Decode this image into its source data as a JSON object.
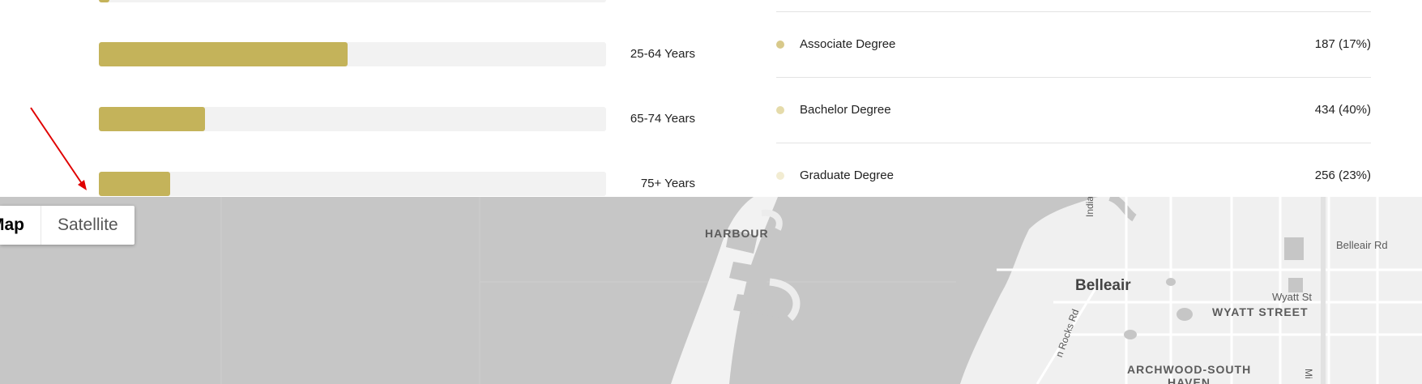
{
  "age_bars": [
    {
      "label": "",
      "value_pct": 2
    },
    {
      "label": "25-64 Years",
      "value_pct": 49
    },
    {
      "label": "65-74 Years",
      "value_pct": 21
    },
    {
      "label": "75+ Years",
      "value_pct": 14
    }
  ],
  "education": {
    "items": [
      {
        "label": "Associate Degree",
        "value": "187 (17%)",
        "color": "#d8c98a"
      },
      {
        "label": "Bachelor Degree",
        "value": "434 (40%)",
        "color": "#e5dbaa"
      },
      {
        "label": "Graduate Degree",
        "value": "256 (23%)",
        "color": "#f2ecd2"
      }
    ]
  },
  "map": {
    "type_control": {
      "map_label": "Map",
      "satellite_label": "Satellite"
    },
    "labels": {
      "harbour": "HARBOUR",
      "belleair": "Belleair",
      "belleair_rd": "Belleair Rd",
      "wyatt_st": "Wyatt St",
      "wyatt_street": "WYATT STREET",
      "archwood_1": "ARCHWOOD-SOUTH",
      "archwood_2": "HAVEN",
      "indian_rocks_1": "Indian Rocks R",
      "indian_rocks_2": "n Rocks Rd",
      "mi": "Mi"
    }
  },
  "colors": {
    "bar_fill": "#c4b35a",
    "bar_track": "#f2f2f2",
    "map_bg": "#c6c6c6",
    "annotation_arrow": "#e00000"
  }
}
